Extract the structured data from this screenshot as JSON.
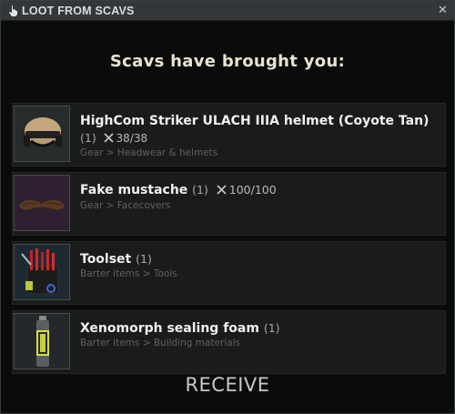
{
  "window": {
    "title": "LOOT FROM SCAVS",
    "close_label": "✕"
  },
  "header": "Scavs have brought you:",
  "items": [
    {
      "name": "HighCom Striker ULACH IIIA helmet (Coyote Tan)",
      "count": "(1)",
      "durability": "38/38",
      "category": "Gear > Headwear & helmets",
      "icon": "helmet-icon"
    },
    {
      "name": "Fake mustache",
      "count": "(1)",
      "durability": "100/100",
      "category": "Gear > Facecovers",
      "icon": "mustache-icon"
    },
    {
      "name": "Toolset",
      "count": "(1)",
      "category": "Barter items > Tools",
      "icon": "toolset-icon"
    },
    {
      "name": "Xenomorph sealing foam",
      "count": "(1)",
      "category": "Barter items > Building materials",
      "icon": "foam-can-icon"
    }
  ],
  "receive_label": "RECEIVE"
}
